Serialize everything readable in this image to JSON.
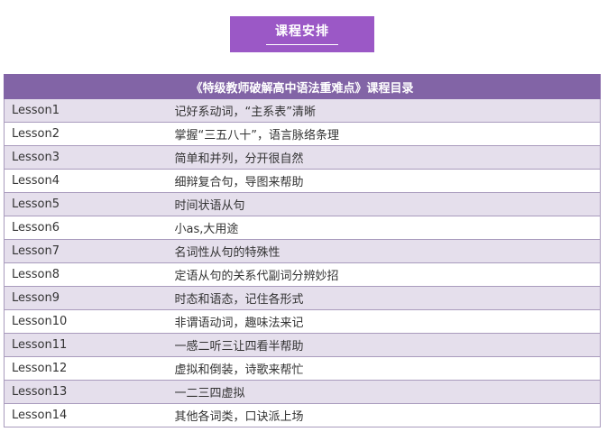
{
  "banner": {
    "title": "课程安排",
    "bg_color": "#9b58c6"
  },
  "table": {
    "header": "《特级教师破解高中语法重难点》课程目录",
    "header_color": "#8264a6",
    "stripe_color": "#e5dfec",
    "rows": [
      {
        "lesson": "Lesson1",
        "topic": "记好系动词，“主系表”清晰"
      },
      {
        "lesson": "Lesson2",
        "topic": "掌握“三五八十”，语言脉络条理"
      },
      {
        "lesson": "Lesson3",
        "topic": "简单和并列，分开很自然"
      },
      {
        "lesson": "Lesson4",
        "topic": "细辩复合句，导图来帮助"
      },
      {
        "lesson": "Lesson5",
        "topic": "时间状语从句"
      },
      {
        "lesson": "Lesson6",
        "topic": "小as,大用途"
      },
      {
        "lesson": "Lesson7",
        "topic": "名词性从句的特殊性"
      },
      {
        "lesson": "Lesson8",
        "topic": "定语从句的关系代副词分辨妙招"
      },
      {
        "lesson": "Lesson9",
        "topic": "时态和语态，记住各形式"
      },
      {
        "lesson": "Lesson10",
        "topic": "非谓语动词，趣味法来记"
      },
      {
        "lesson": "Lesson11",
        "topic": "一感二听三让四看半帮助"
      },
      {
        "lesson": "Lesson12",
        "topic": "虚拟和倒装，诗歌来帮忙"
      },
      {
        "lesson": "Lesson13",
        "topic": "一二三四虚拟"
      },
      {
        "lesson": "Lesson14",
        "topic": "其他各词类，口诀派上场"
      }
    ]
  }
}
